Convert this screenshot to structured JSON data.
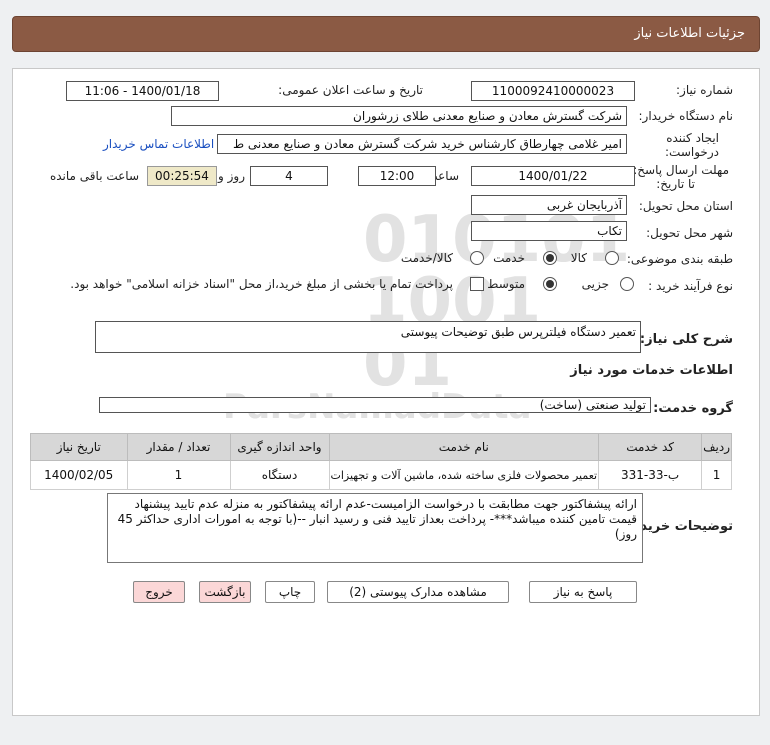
{
  "header": {
    "title": "جزئیات اطلاعات نیاز"
  },
  "fields": {
    "need_number_label": "شماره نیاز:",
    "need_number": "1100092410000023",
    "announce_label": "تاریخ و ساعت اعلان عمومی:",
    "announce_value": "1400/01/18 - 11:06",
    "buyer_org_label": "نام دستگاه خریدار:",
    "buyer_org": "شرکت گسترش معادن و صنایع معدنی طلای زرشوران",
    "requester_label_1": "ایجاد کننده",
    "requester_label_2": "درخواست:",
    "requester": "امیر  غلامی چهارطاق کارشناس خرید شرکت گسترش معادن و صنایع معدنی ط",
    "contact_link": "اطلاعات تماس خریدار",
    "deadline_label_1": "مهلت ارسال پاسخ:",
    "deadline_label_2": "تا تاریخ:",
    "deadline_date": "1400/01/22",
    "time_label": "ساعت",
    "deadline_time": "12:00",
    "days_value": "4",
    "days_label": "روز و",
    "remaining_time": "00:25:54",
    "remaining_label": "ساعت باقی مانده",
    "province_label": "استان محل تحویل:",
    "province": "آذربایجان غربی",
    "city_label": "شهر محل تحویل:",
    "city": "تکاب",
    "category_label": "طبقه بندی موضوعی:",
    "category_options": [
      "کالا",
      "خدمت",
      "کالا/خدمت"
    ],
    "category_selected": "خدمت",
    "process_label": "نوع فرآیند خرید :",
    "process_options": [
      "جزیی",
      "متوسط"
    ],
    "process_selected": "متوسط",
    "treasury_note": "پرداخت تمام یا بخشی از مبلغ خرید،از محل \"اسناد خزانه اسلامی\" خواهد بود."
  },
  "summary": {
    "label": "شرح کلی نیاز:",
    "value": "تعمیر دستگاه فیلترپرس طبق توضیحات پیوستی"
  },
  "services": {
    "section_title": "اطلاعات خدمات مورد نیاز",
    "group_label": "گروه خدمت:",
    "group_value": "تولید صنعتی (ساخت)"
  },
  "table": {
    "headers": [
      "ردیف",
      "کد خدمت",
      "نام خدمت",
      "واحد اندازه گیری",
      "تعداد / مقدار",
      "تاریخ نیاز"
    ],
    "rows": [
      [
        "1",
        "ب-33-331",
        "تعمیر محصولات فلزی ساخته شده، ماشین آلات و تجهیزات",
        "دستگاه",
        "1",
        "1400/02/05"
      ]
    ]
  },
  "buyer_notes": {
    "label": "توضیحات خریدار:",
    "line1": "ارائه پیشفاکتور جهت مطابقت با درخواست  الزامیست-عدم ارائه پیشفاکتور به منزله عدم تایید پیشنهاد",
    "line2": "قیمت تامین کننده میباشد***- پرداخت بعداز تایید فنی و رسید انبار --(با توجه به امورات اداری حداکثر 45",
    "line3": "روز)"
  },
  "buttons": {
    "reply": "پاسخ به نیاز",
    "attachments": "مشاهده مدارک پیوستی (2)",
    "print": "چاپ",
    "back": "بازگشت",
    "exit": "خروج"
  },
  "colors": {
    "header_bg": "#8b5a44",
    "link": "#1a4fc0",
    "remaining_bg": "#efe9c8",
    "back_exit_bg": "#fbd7d7"
  }
}
